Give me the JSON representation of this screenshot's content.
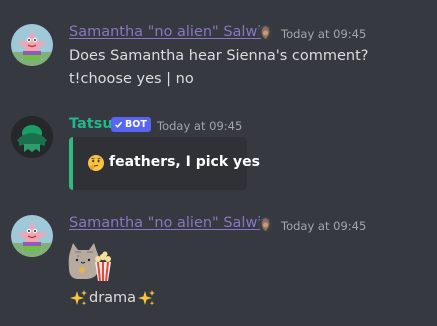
{
  "messages": [
    {
      "author": "Samantha \"no alien\" Salwis",
      "timestamp": "Today at 09:45",
      "lines": [
        "Does Samantha hear Sienna's comment?",
        "t!choose yes | no"
      ]
    },
    {
      "author": "Tatsu",
      "bot_badge": "BOT",
      "timestamp": "Today at 09:45",
      "embed_text": "feathers, I pick yes"
    },
    {
      "author": "Samantha \"no alien\" Salwis",
      "timestamp": "Today at 09:45",
      "text": "drama"
    }
  ],
  "colors": {
    "background": "#36393f",
    "samantha_name": "#8b75c2",
    "tatsu_name": "#1fb98a",
    "bot_badge": "#5865f2",
    "embed_bar": "#2dbc7e",
    "embed_bg": "#2f3136"
  },
  "icons": [
    "patrick-star-avatar",
    "role-icon",
    "tatsu-avatar",
    "verified-check-icon",
    "thinking-emoji",
    "sparkles-emoji",
    "pusheen-popcorn-sticker"
  ]
}
